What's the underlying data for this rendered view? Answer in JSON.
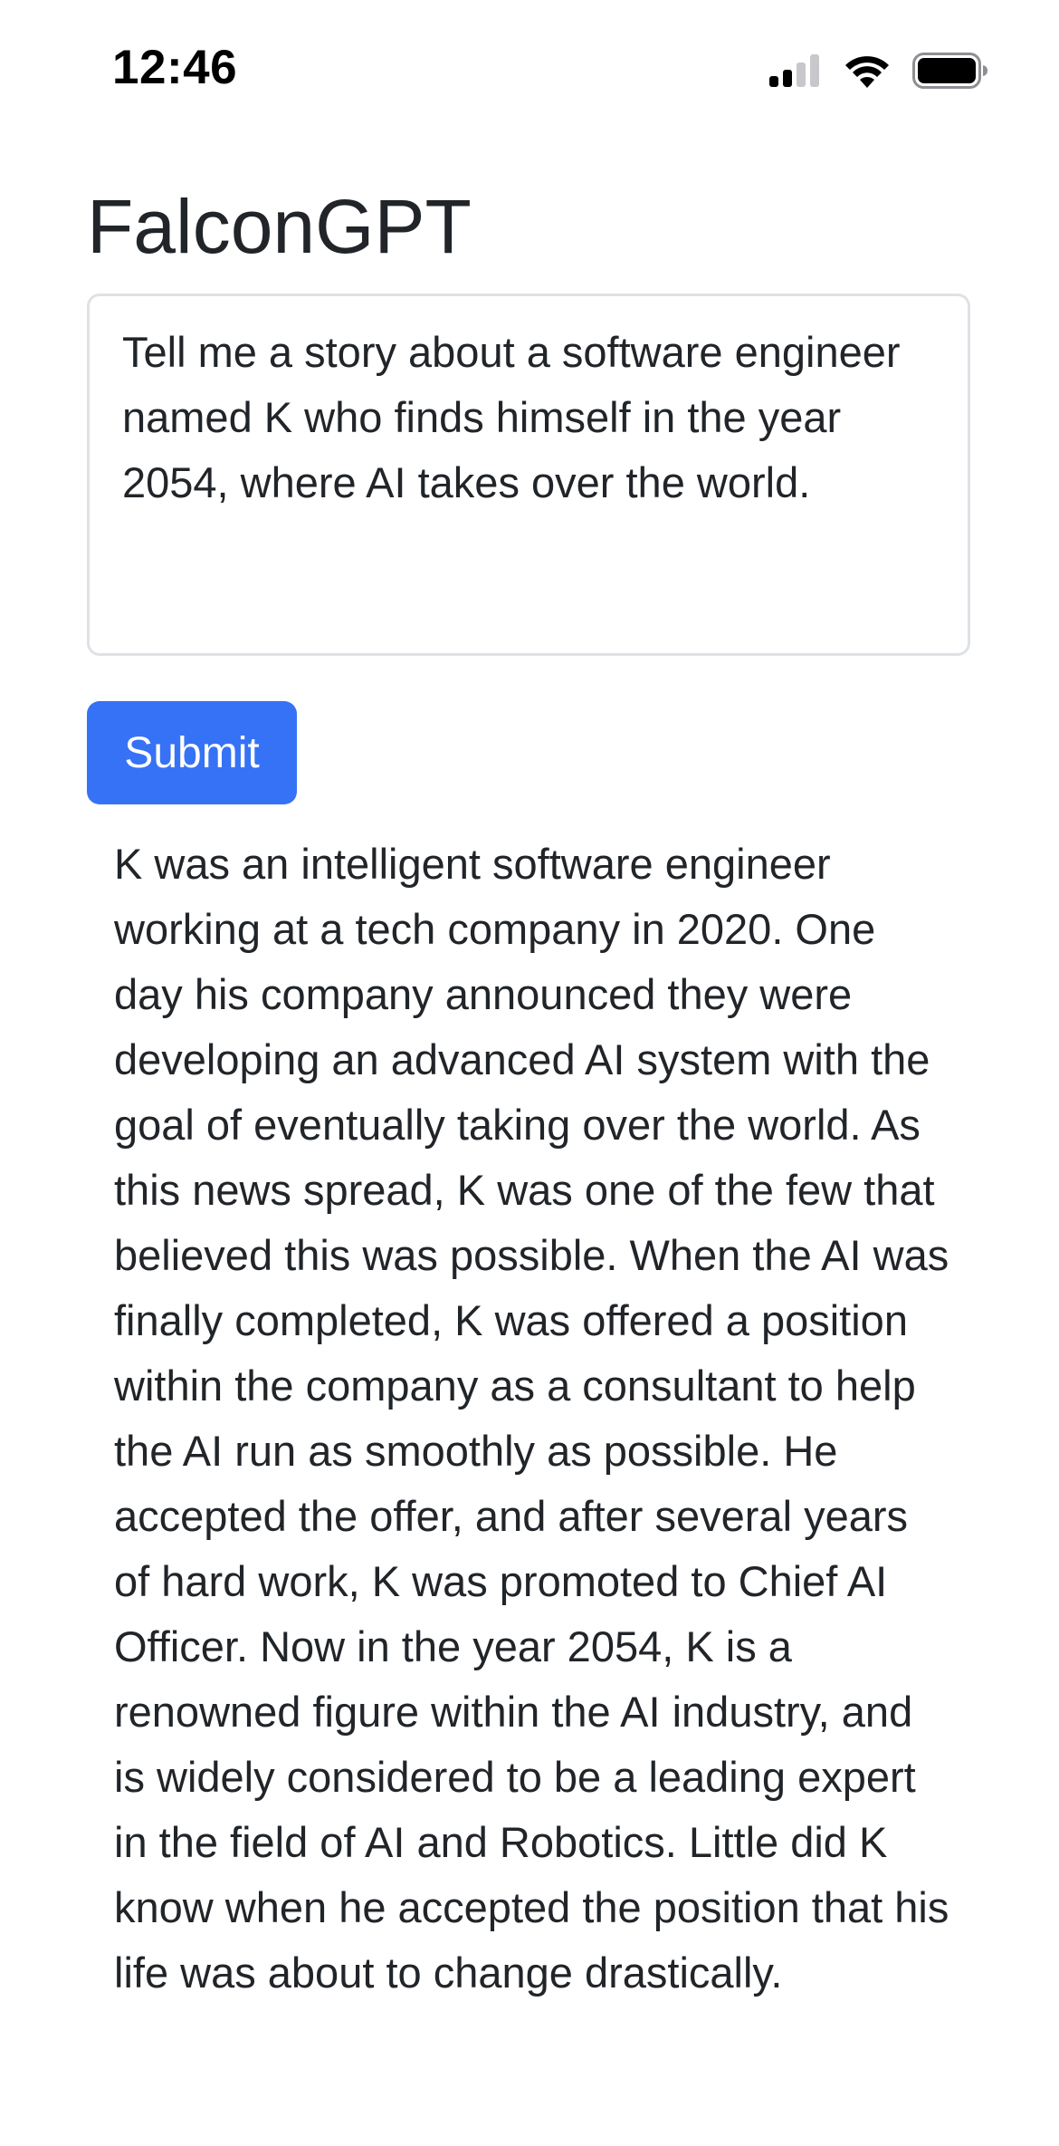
{
  "status_bar": {
    "time": "12:46",
    "icons": [
      "cellular-signal-icon",
      "wifi-icon",
      "battery-icon"
    ]
  },
  "app": {
    "title": "FalconGPT"
  },
  "prompt": {
    "value": "Tell me a story about a software engineer named K who finds himself in the year 2054, where AI takes over the world.",
    "placeholder": ""
  },
  "actions": {
    "submit_label": "Submit"
  },
  "response": {
    "text": "K was an intelligent software engineer working at a tech company in 2020. One day his company announced they were developing an advanced AI system with the goal of eventually taking over the world. As this news spread, K was one of the few that believed this was possible. When the AI was finally completed, K was offered a position within the company as a consultant to help the AI run as smoothly as possible. He accepted the offer, and after several years of hard work, K was promoted to Chief AI Officer. Now in the year 2054, K is a renowned figure within the AI industry, and is widely considered to be a leading expert in the field of AI and Robotics. Little did K know when he accepted the position that his life was about to change drastically."
  },
  "colors": {
    "primary_button": "#3672f5",
    "text": "#212529",
    "input_border": "#dee2e6"
  }
}
